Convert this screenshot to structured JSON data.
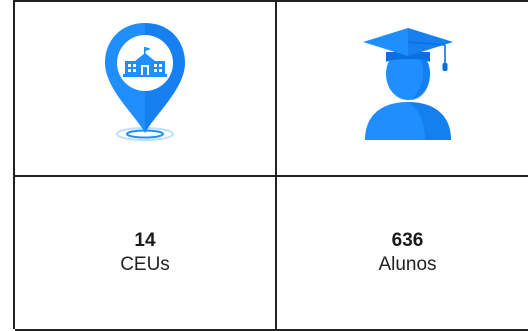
{
  "stats": [
    {
      "value": "14",
      "label": "CEUs",
      "icon": "school-location-pin-icon"
    },
    {
      "value": "636",
      "label": "Alunos",
      "icon": "graduate-student-icon"
    }
  ],
  "colors": {
    "accent": "#1f8fff",
    "accent_dark": "#0a6fe0",
    "border": "#222222"
  }
}
